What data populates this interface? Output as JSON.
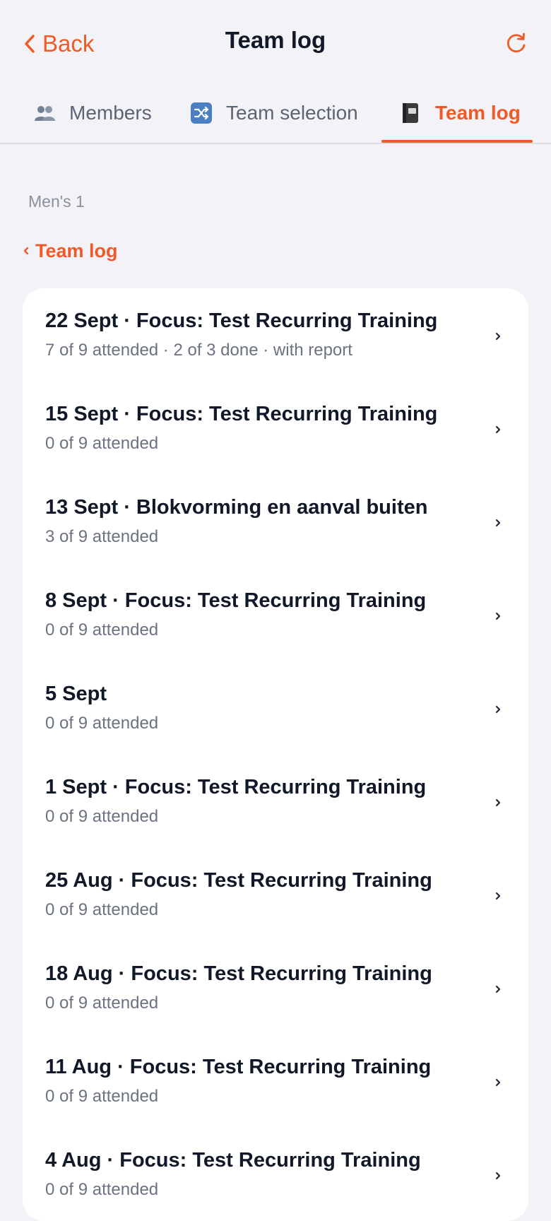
{
  "header": {
    "back_label": "Back",
    "title": "Team log",
    "refresh_icon": "refresh-icon"
  },
  "tabs": [
    {
      "label": "Members",
      "icon": "people-icon",
      "active": false
    },
    {
      "label": "Team selection",
      "icon": "shuffle-icon",
      "active": false
    },
    {
      "label": "Team log",
      "icon": "notebook-icon",
      "active": true
    }
  ],
  "team": {
    "name": "Men's 1"
  },
  "breadcrumb": {
    "label": "Team log"
  },
  "entries": [
    {
      "title": "22 Sept · Focus: Test Recurring Training",
      "subtitle": "7 of 9 attended · 2 of 3 done · with report"
    },
    {
      "title": "15 Sept · Focus: Test Recurring Training",
      "subtitle": "0 of 9 attended"
    },
    {
      "title": "13 Sept · Blokvorming en aanval buiten",
      "subtitle": "3 of 9 attended"
    },
    {
      "title": "8 Sept · Focus: Test Recurring Training",
      "subtitle": "0 of 9 attended"
    },
    {
      "title": "5 Sept",
      "subtitle": "0 of 9 attended"
    },
    {
      "title": "1 Sept · Focus: Test Recurring Training",
      "subtitle": "0 of 9 attended"
    },
    {
      "title": "25 Aug · Focus: Test Recurring Training",
      "subtitle": "0 of 9 attended"
    },
    {
      "title": "18 Aug · Focus: Test Recurring Training",
      "subtitle": "0 of 9 attended"
    },
    {
      "title": "11 Aug · Focus: Test Recurring Training",
      "subtitle": "0 of 9 attended"
    },
    {
      "title": "4 Aug · Focus: Test Recurring Training",
      "subtitle": "0 of 9 attended"
    }
  ],
  "colors": {
    "accent": "#f05a28",
    "background": "#f2f2f7",
    "card": "#ffffff",
    "text_primary": "#111827",
    "text_secondary": "#6b7280"
  }
}
